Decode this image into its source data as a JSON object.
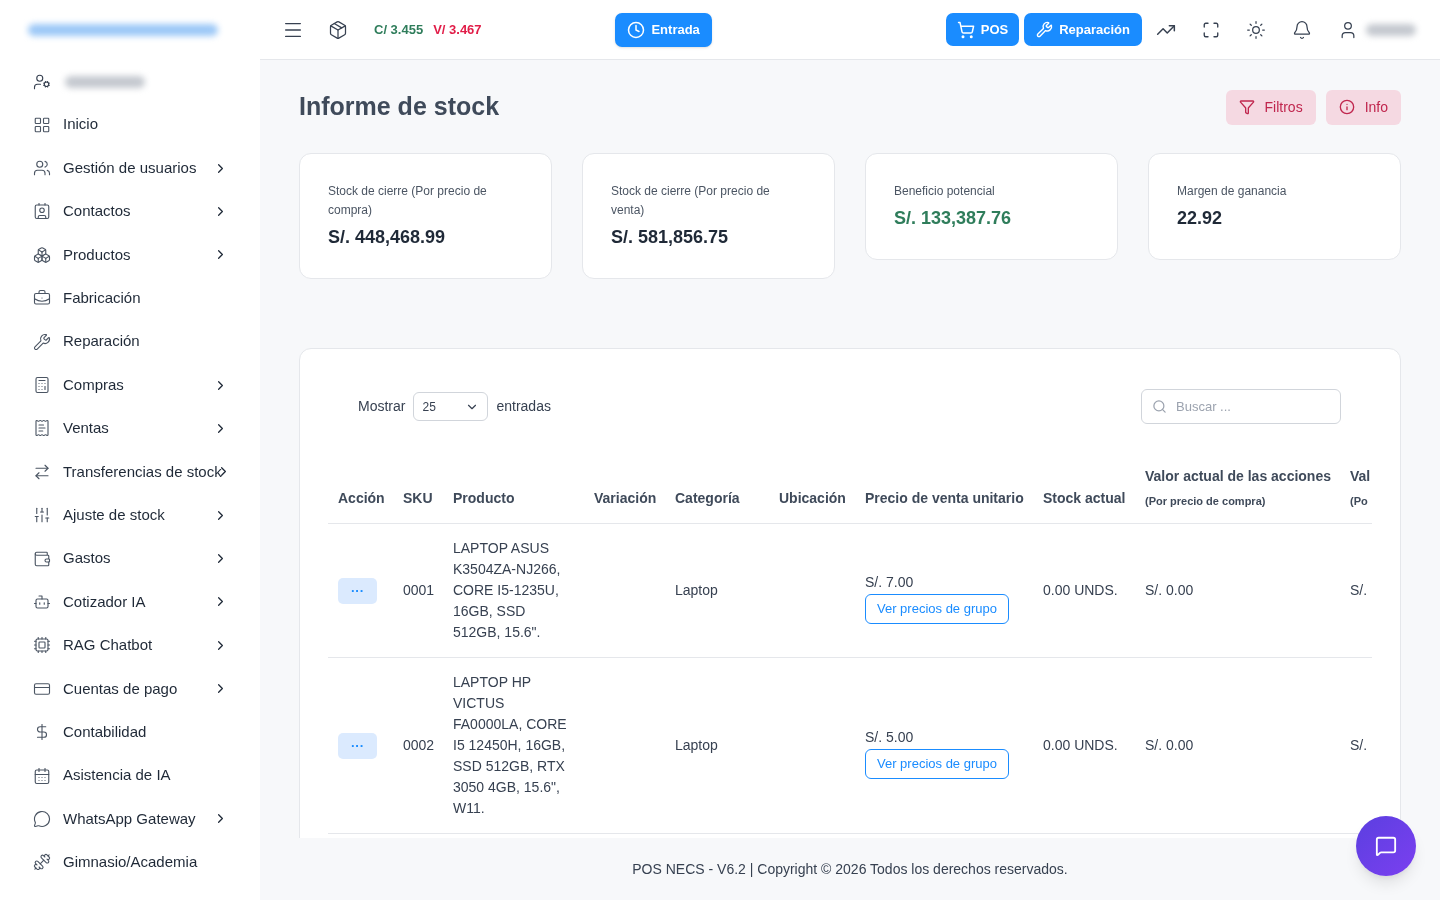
{
  "header": {
    "rates": [
      {
        "label": "C/ 3.455",
        "color": "#2f7d5b"
      },
      {
        "label": "V/ 3.467",
        "color": "#e11d48"
      }
    ],
    "entry_button": "Entrada",
    "pos_button": "POS",
    "repair_button": "Reparación"
  },
  "sidebar": {
    "items": [
      {
        "label": "Inicio",
        "submenu": false
      },
      {
        "label": "Gestión de usuarios",
        "submenu": true
      },
      {
        "label": "Contactos",
        "submenu": true
      },
      {
        "label": "Productos",
        "submenu": true
      },
      {
        "label": "Fabricación",
        "submenu": false
      },
      {
        "label": "Reparación",
        "submenu": false
      },
      {
        "label": "Compras",
        "submenu": true
      },
      {
        "label": "Ventas",
        "submenu": true
      },
      {
        "label": "Transferencias de stock",
        "submenu": true
      },
      {
        "label": "Ajuste de stock",
        "submenu": true
      },
      {
        "label": "Gastos",
        "submenu": true
      },
      {
        "label": "Cotizador IA",
        "submenu": true
      },
      {
        "label": "RAG Chatbot",
        "submenu": true
      },
      {
        "label": "Cuentas de pago",
        "submenu": true
      },
      {
        "label": "Contabilidad",
        "submenu": false
      },
      {
        "label": "Asistencia de IA",
        "submenu": false
      },
      {
        "label": "WhatsApp Gateway",
        "submenu": true
      },
      {
        "label": "Gimnasio/Academia",
        "submenu": false
      }
    ]
  },
  "page": {
    "title": "Informe de stock",
    "filters_button": "Filtros",
    "info_button": "Info"
  },
  "cards": [
    {
      "label": "Stock de cierre (Por precio de compra)",
      "value": "S/. 448,468.99",
      "color": "#1f2937"
    },
    {
      "label": "Stock de cierre (Por precio de venta)",
      "value": "S/. 581,856.75",
      "color": "#1f2937"
    },
    {
      "label": "Beneficio potencial",
      "value": "S/. 133,387.76",
      "color": "#2f7d5b"
    },
    {
      "label": "Margen de ganancia",
      "value": "22.92",
      "color": "#1f2937"
    }
  ],
  "table": {
    "show_label": "Mostrar",
    "page_size": "25",
    "entries_label": "entradas",
    "search_placeholder": "Buscar ...",
    "columns": [
      {
        "title": "Acción"
      },
      {
        "title": "SKU"
      },
      {
        "title": "Producto"
      },
      {
        "title": "Variación"
      },
      {
        "title": "Categoría"
      },
      {
        "title": "Ubicación"
      },
      {
        "title": "Precio de venta unitario"
      },
      {
        "title": "Stock actual"
      },
      {
        "title": "Valor actual de las acciones",
        "subtitle": "(Por precio de compra)"
      },
      {
        "title": "Val",
        "subtitle": "(Po"
      }
    ],
    "rows": [
      {
        "action": "···",
        "sku": "0001",
        "product": "LAPTOP ASUS K3504ZA-NJ266, CORE I5-1235U, 16GB, SSD 512GB, 15.6\".",
        "category": "Laptop",
        "price": "S/. 7.00",
        "group_prices": "Ver precios de grupo",
        "stock": "0.00 UNDS.",
        "value": "S/. 0.00",
        "column_10": "S/."
      },
      {
        "action": "···",
        "sku": "0002",
        "product": "LAPTOP HP VICTUS FA0000LA, CORE I5 12450H, 16GB, SSD 512GB, RTX 3050 4GB, 15.6\", W11.",
        "category": "Laptop",
        "price": "S/. 5.00",
        "group_prices": "Ver precios de grupo",
        "stock": "0.00 UNDS.",
        "value": "S/. 0.00",
        "column_10": "S/."
      }
    ]
  },
  "footer": "POS NECS - V6.2 | Copyright © 2026 Todos los derechos reservados."
}
